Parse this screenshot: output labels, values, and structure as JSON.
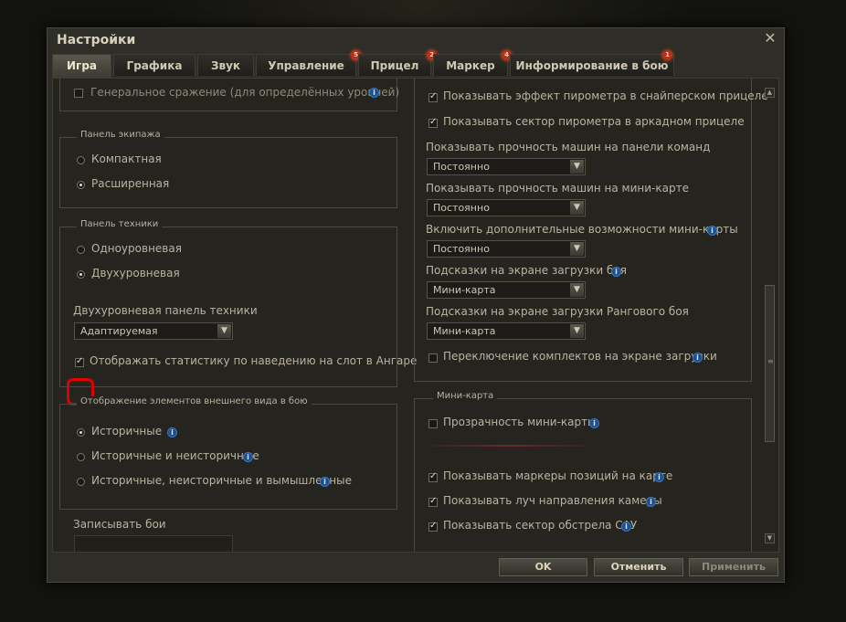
{
  "dialog": {
    "title": "Настройки"
  },
  "tabs": [
    {
      "label": "Игра",
      "badge": null
    },
    {
      "label": "Графика",
      "badge": null
    },
    {
      "label": "Звук",
      "badge": null
    },
    {
      "label": "Управление",
      "badge": "5"
    },
    {
      "label": "Прицел",
      "badge": "2"
    },
    {
      "label": "Маркер",
      "badge": "4"
    },
    {
      "label": "Информирование в бою",
      "badge": "1"
    }
  ],
  "left": {
    "general_battle": {
      "label": "Генеральное сражение (для определённых уровней)",
      "checked": false
    },
    "crew_panel": {
      "title": "Панель экипажа",
      "options": [
        {
          "label": "Компактная",
          "selected": false
        },
        {
          "label": "Расширенная",
          "selected": true
        }
      ]
    },
    "vehicle_panel": {
      "title": "Панель техники",
      "options": [
        {
          "label": "Одноуровневая",
          "selected": false
        },
        {
          "label": "Двухуровневая",
          "selected": true
        }
      ],
      "dropdown_label": "Двухуровневая панель техники",
      "dropdown_value": "Адаптируемая",
      "show_stats": {
        "label": "Отображать статистику по наведению на слот в Ангаре",
        "checked": true
      }
    },
    "appearance": {
      "title": "Отображение элементов внешнего вида в бою",
      "options": [
        {
          "label": "Историчные",
          "selected": true
        },
        {
          "label": "Историчные и неисторичные",
          "selected": false
        },
        {
          "label": "Историчные, неисторичные и вымышленные",
          "selected": false
        }
      ]
    },
    "record_battles": {
      "label": "Записывать бои"
    }
  },
  "right": {
    "pyrometer_sniper": {
      "label": "Показывать эффект пирометра в снайперском прицеле",
      "checked": true
    },
    "pyrometer_arcade": {
      "label": "Показывать сектор пирометра в аркадном прицеле",
      "checked": true
    },
    "hp_team_panel": {
      "label": "Показывать прочность машин на панели команд",
      "value": "Постоянно"
    },
    "hp_minimap": {
      "label": "Показывать прочность машин на мини-карте",
      "value": "Постоянно"
    },
    "minimap_extra": {
      "label": "Включить дополнительные возможности мини-карты",
      "value": "Постоянно"
    },
    "loading_hints": {
      "label": "Подсказки на экране загрузки боя",
      "value": "Мини-карта"
    },
    "ranked_hints": {
      "label": "Подсказки на экране загрузки Рангового боя",
      "value": "Мини-карта"
    },
    "kits_switch": {
      "label": "Переключение комплектов на экране загрузки",
      "checked": false
    },
    "minimap": {
      "title": "Мини-карта",
      "transparency": {
        "label": "Прозрачность мини-карты",
        "checked": false
      },
      "position_markers": {
        "label": "Показывать маркеры позиций на карте",
        "checked": true
      },
      "camera_ray": {
        "label": "Показывать луч направления камеры",
        "checked": true
      },
      "spg_sector": {
        "label": "Показывать сектор обстрела САУ",
        "checked": true
      }
    }
  },
  "buttons": {
    "ok": "OK",
    "cancel": "Отменить",
    "apply": "Применить"
  },
  "icons": {
    "close": "close-icon",
    "info": "info-icon",
    "scroll_up": "chevron-up-icon",
    "scroll_down": "chevron-down-icon"
  },
  "colors": {
    "badge": "#b8301a",
    "info": "#1f4f8a",
    "annotation": "#e00000"
  }
}
